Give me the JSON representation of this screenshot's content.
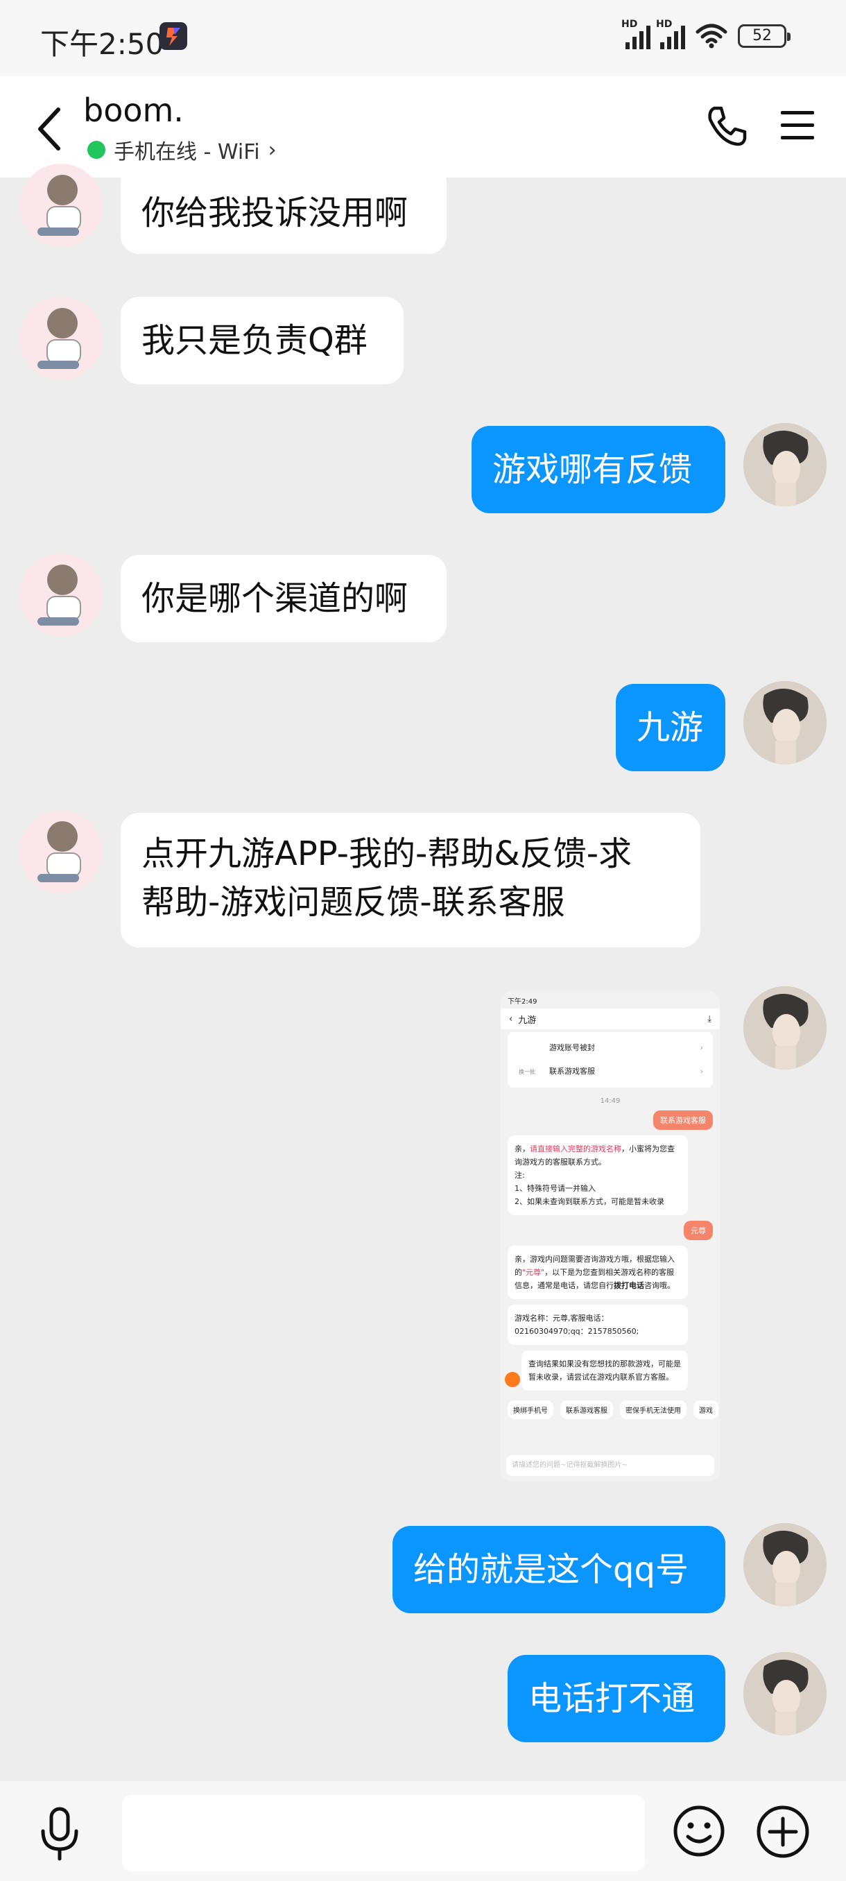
{
  "status_bar": {
    "time": "下午2:50",
    "signal_badge": "HD",
    "battery": "52",
    "icons": [
      "app-icon",
      "signal-icon",
      "wifi-icon",
      "battery-icon"
    ]
  },
  "header": {
    "title": "boom.",
    "subtitle": "手机在线 - WiFi",
    "online_color": "#22c55e",
    "icons": [
      "back-icon",
      "phone-icon",
      "menu-icon"
    ]
  },
  "messages": [
    {
      "side": "left",
      "text": "你给我投诉没用啊"
    },
    {
      "side": "left",
      "text": "我只是负责Q群"
    },
    {
      "side": "right",
      "text": "游戏哪有反馈"
    },
    {
      "side": "left",
      "text": "你是哪个渠道的啊"
    },
    {
      "side": "right",
      "text": "九游"
    },
    {
      "side": "left",
      "text_line1": "点开九游APP-我的-帮助&反馈-求",
      "text_line2": "帮助-游戏问题反馈-联系客服"
    },
    {
      "side": "right",
      "type": "image"
    },
    {
      "side": "right",
      "text": "给的就是这个qq号"
    },
    {
      "side": "right",
      "text": "电话打不通"
    }
  ],
  "shared_image": {
    "time": "下午2:49",
    "title": "九游",
    "menu_items": [
      "游戏账号被封",
      "联系游戏客服"
    ],
    "switch_label": "换一批",
    "timestamp": "14:49",
    "out_msg_1": "联系游戏客服",
    "in_msg_1_prefix": "亲，",
    "in_msg_1_red": "请直接输入完整的游戏名称",
    "in_msg_1_rest": "，小蜜将为您查询游戏方的客服联系方式。",
    "in_msg_1_note": "注:",
    "in_msg_1_l1": "1、特殊符号请一并输入",
    "in_msg_1_l2": "2、如果未查询到联系方式，可能是暂未收录",
    "out_msg_2": "元尊",
    "in_msg_2_a": "亲，游戏内问题需要咨询游戏方哦，根据您输入的",
    "in_msg_2_red": "\"元尊\"",
    "in_msg_2_b": "，以下是为您查到相关游戏名称的客服信息，通常是电话，请您自行",
    "in_msg_2_bold": "拨打电话",
    "in_msg_2_c": "咨询哦。",
    "in_msg_3": "游戏名称：元尊,客服电话：02160304970;qq：2157850560;",
    "in_msg_4": "查询结果如果没有您想找的那款游戏，可能是暂未收录，请尝试在游戏内联系官方客服。",
    "chips": [
      "换绑手机号",
      "联系游戏客服",
      "密保手机无法使用",
      "游戏"
    ],
    "input_placeholder": "请描述您的问题~记得抠截解换图片~"
  },
  "accent_colors": {
    "outgoing_bubble": "#0b95ff",
    "incoming_bubble": "#ffffff",
    "background": "#ededed"
  },
  "bottom_bar": {
    "icons": [
      "mic-icon",
      "emoji-icon",
      "plus-icon"
    ]
  }
}
